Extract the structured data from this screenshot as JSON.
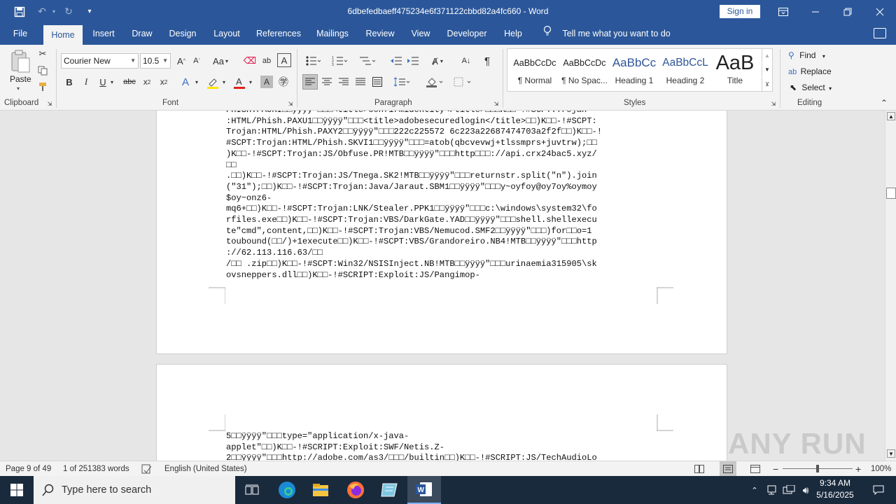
{
  "titlebar": {
    "doc_title": "6dbefedbaeff475234e6f371122cbbd82a4fc660  -  Word",
    "sign_in": "Sign in"
  },
  "tabs": [
    "File",
    "Home",
    "Insert",
    "Draw",
    "Design",
    "Layout",
    "References",
    "Mailings",
    "Review",
    "View",
    "Developer",
    "Help"
  ],
  "tell_me": "Tell me what you want to do",
  "ribbon": {
    "clipboard": {
      "paste": "Paste",
      "label": "Clipboard"
    },
    "font": {
      "name": "Courier New",
      "size": "10.5",
      "label": "Font",
      "change_case": "Aa"
    },
    "paragraph": {
      "label": "Paragraph"
    },
    "styles": {
      "label": "Styles",
      "items": [
        {
          "preview": "AaBbCcDc",
          "name": "¶ Normal"
        },
        {
          "preview": "AaBbCcDc",
          "name": "¶ No Spac..."
        },
        {
          "preview": "AaBbCc",
          "name": "Heading 1"
        },
        {
          "preview": "AaBbCcL",
          "name": "Heading 2"
        },
        {
          "preview": "AaB",
          "name": "Title"
        }
      ]
    },
    "editing": {
      "label": "Editing",
      "find": "Find",
      "replace": "Replace",
      "select": "Select"
    }
  },
  "document": {
    "page1_lines": [
      "PHISH:PAUKI□□ÿÿÿÿ\"□□□<title>confirmidentity</title>□□□K□□-!#SCPT:Trojan",
      ":HTML/Phish.PAXU1□□ÿÿÿÿ\"□□□<title>adobesecuredlogin</title>□□)K□□-!#SCPT:",
      "Trojan:HTML/Phish.PAXY2□□ÿÿÿÿ\"□□□222c225572 6c223a22687474703a2f2f□□)K□□-!",
      "#SCPT:Trojan:HTML/Phish.SKVI1□□ÿÿÿÿ\"□□□=atob(qbcvevwj+tlssmprs+juvtrw);□□",
      ")K□□-!#SCPT:Trojan:JS/Obfuse.PR!MTB□□ÿÿÿÿ\"□□□http□□□://api.crx24bac5.xyz/",
      "□□",
      ".□□)K□□-!#SCPT:Trojan:JS/Tnega.SK2!MTB□□ÿÿÿÿ\"□□□returnstr.split(\"n\").join",
      "(\"31\");□□)K□□-!#SCPT:Trojan:Java/Jaraut.SBM1□□ÿÿÿÿ\"□□□y~oyfoy@oy7oy%oymoy",
      "$oy~onz6-",
      "mq6+□□)K□□-!#SCPT:Trojan:LNK/Stealer.PPK1□□ÿÿÿÿ\"□□□c:\\windows\\system32\\fo",
      "rfiles.exe□□)K□□-!#SCPT:Trojan:VBS/DarkGate.YAD□□ÿÿÿÿ\"□□□shell.shellexecu",
      "te\"cmd\",content,□□)K□□-!#SCPT:Trojan:VBS/Nemucod.SMF2□□ÿÿÿÿ\"□□□)for□□o=1",
      "toubound(□□/)+1execute□□)K□□-!#SCPT:VBS/Grandoreiro.NB4!MTB□□ÿÿÿÿ\"□□□http",
      "://62.113.116.63/□□",
      "/□□ .zip□□)K□□-!#SCPT:Win32/NSISInject.NB!MTB□□ÿÿÿÿ\"□□□urinaemia315905\\sk",
      "ovsneppers.dll□□)K□□-!#SCRIPT:Exploit:JS/Pangimop-"
    ],
    "page2_lines": [
      "5□□ÿÿÿÿ\"□□□type=\"application/x-java-",
      "applet\"□□)K□□-!#SCRIPT:Exploit:SWF/Netis.Z-",
      "2□□ÿÿÿÿ\"□□□http://adobe.com/as3/□□□/builtin□□)K□□-!#SCRIPT:JS/TechAudioLo"
    ]
  },
  "status": {
    "page": "Page 9 of 49",
    "words": "1 of 251383 words",
    "language": "English (United States)",
    "zoom": "100%"
  },
  "taskbar": {
    "search_placeholder": "Type here to search",
    "time": "9:34 AM",
    "date": "5/16/2025"
  },
  "watermark": "ANY RUN",
  "colors": {
    "word_blue": "#2b579a",
    "taskbar": "#1a2a3d"
  }
}
